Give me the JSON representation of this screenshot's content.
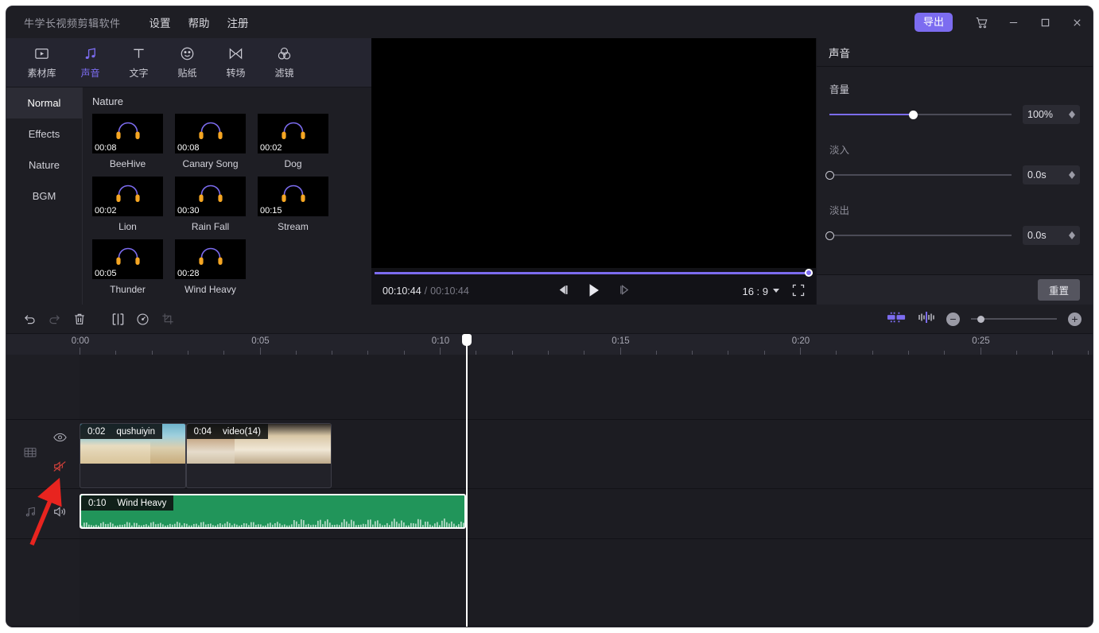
{
  "titlebar": {
    "app_title": "牛学长视频剪辑软件",
    "menus": [
      {
        "label": "设置",
        "name": "menu-settings"
      },
      {
        "label": "帮助",
        "name": "menu-help"
      },
      {
        "label": "注册",
        "name": "menu-register"
      }
    ],
    "export_label": "导出",
    "icons": {
      "cart": "cart-icon",
      "minimize": "minimize-icon",
      "maximize": "maximize-icon",
      "close": "close-icon"
    }
  },
  "library": {
    "tools": [
      {
        "label": "素材库",
        "icon": "media-library-icon",
        "active": false
      },
      {
        "label": "声音",
        "icon": "music-note-icon",
        "active": true
      },
      {
        "label": "文字",
        "icon": "text-icon",
        "active": false
      },
      {
        "label": "贴纸",
        "icon": "sticker-smiley-icon",
        "active": false
      },
      {
        "label": "转场",
        "icon": "transition-icon",
        "active": false
      },
      {
        "label": "滤镜",
        "icon": "filter-circles-icon",
        "active": false
      }
    ],
    "categories": [
      {
        "label": "Normal",
        "active": true
      },
      {
        "label": "Effects",
        "active": false
      },
      {
        "label": "Nature",
        "active": false
      },
      {
        "label": "BGM",
        "active": false
      }
    ],
    "group_title": "Nature",
    "audio_items": [
      {
        "name": "BeeHive",
        "duration": "00:08"
      },
      {
        "name": "Canary Song",
        "duration": "00:08"
      },
      {
        "name": "Dog",
        "duration": "00:02"
      },
      {
        "name": "Lion",
        "duration": "00:02"
      },
      {
        "name": "Rain Fall",
        "duration": "00:30"
      },
      {
        "name": "Stream",
        "duration": "00:15"
      },
      {
        "name": "Thunder",
        "duration": "00:05"
      },
      {
        "name": "Wind Heavy",
        "duration": "00:28"
      }
    ]
  },
  "preview": {
    "current_time": "00:10:44",
    "separator": "/",
    "total_time": "00:10:44",
    "progress_percent": 100,
    "aspect_ratio": "16 : 9",
    "controls": {
      "prev_frame": "previous-frame-icon",
      "play": "play-icon",
      "next_frame": "next-frame-icon",
      "fullscreen": "fullscreen-icon",
      "ratio_caret": "chevron-down-icon"
    }
  },
  "properties": {
    "title": "声音",
    "rows": [
      {
        "label": "音量",
        "value": "100%",
        "fill_percent": 46,
        "dim": false
      },
      {
        "label": "淡入",
        "value": "0.0s",
        "fill_percent": 0,
        "dim": true
      },
      {
        "label": "淡出",
        "value": "0.0s",
        "fill_percent": 0,
        "dim": true
      }
    ],
    "reset_label": "重置"
  },
  "timeline": {
    "toolbar": [
      {
        "name": "undo-button",
        "icon": "undo-icon",
        "disabled": false
      },
      {
        "name": "redo-button",
        "icon": "redo-icon",
        "disabled": true
      },
      {
        "name": "delete-button",
        "icon": "trash-icon",
        "disabled": false
      },
      {
        "name": "split-button",
        "icon": "split-icon",
        "disabled": false
      },
      {
        "name": "speed-button",
        "icon": "speed-gauge-icon",
        "disabled": false
      },
      {
        "name": "crop-button",
        "icon": "crop-icon",
        "disabled": true
      }
    ],
    "right_controls": {
      "fit_icon": "fit-to-window-icon",
      "align_icon": "align-to-playhead-icon",
      "zoom_out_label": "−",
      "zoom_in_label": "+",
      "zoom_position_percent": 12
    },
    "ruler_labels": [
      "0:00",
      "0:05",
      "0:10",
      "0:15",
      "0:20",
      "0:25"
    ],
    "ruler_seconds_per_label": 5,
    "pixels_per_second": 45.3,
    "playhead_seconds": 10.72,
    "tracks": [
      {
        "name": "video-track",
        "head_icon": "film-strip-icon",
        "eye_icon": "eye-visible-icon",
        "audio_icon": "speaker-muted-icon",
        "muted": true,
        "clips": [
          {
            "label": "qushuiyin",
            "duration": "0:02",
            "start_seconds": 0,
            "length_seconds": 2.95,
            "type": "video"
          },
          {
            "label": "video(14)",
            "duration": "0:04",
            "start_seconds": 2.95,
            "length_seconds": 4.04,
            "type": "video"
          }
        ]
      },
      {
        "name": "audio-track",
        "head_icon": "music-note-icon",
        "audio_icon": "speaker-on-icon",
        "muted": false,
        "clips": [
          {
            "label": "Wind Heavy",
            "duration": "0:10",
            "start_seconds": 0,
            "length_seconds": 10.72,
            "type": "audio",
            "selected": true
          }
        ]
      }
    ]
  },
  "annotation": {
    "name": "red-arrow-pointer",
    "color": "#e8241f",
    "points_at": "video-track-mute-icon"
  },
  "colors": {
    "accent": "#7c6cf0",
    "audio_clip": "#21955a",
    "panel_bg": "#1e1e24",
    "timeline_bg": "#1c1c22",
    "mute_red": "#d0403a"
  }
}
